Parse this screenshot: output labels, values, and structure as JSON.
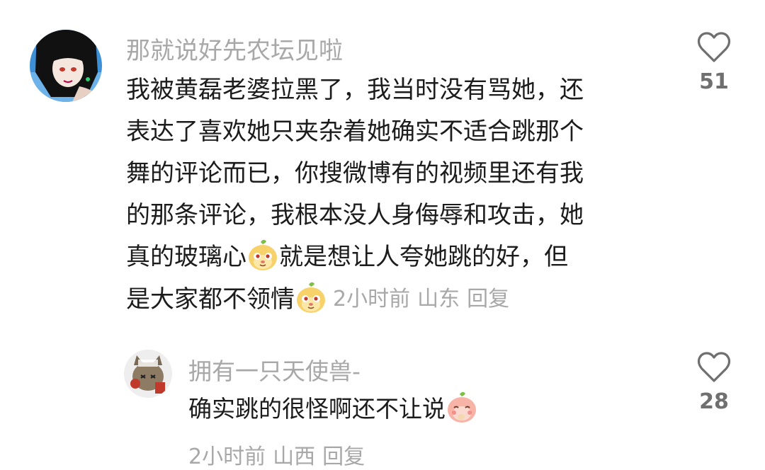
{
  "comments": [
    {
      "username": "那就说好先农坛见啦",
      "lines": [
        "我被黄磊老婆拉黑了，我当时没有骂她，还",
        "表达了喜欢她只夹杂着她确实不适合跳那个",
        "舞的评论而已，你搜微博有的视频里还有我",
        "的那条评论，我根本没人身侮辱和攻击，她"
      ],
      "line5_part1": "真的玻璃心",
      "line5_part2": "就是想让人夸她跳的好，但",
      "line6_part1": "是大家都不领情",
      "time": "2小时前",
      "location": "山东",
      "reply_label": "回复",
      "likes": "51",
      "emoji": "cheeky-face-sticker"
    },
    {
      "username": "拥有一只天使兽-",
      "text": "确实跳的很怪啊还不让说",
      "time": "2小时前",
      "location": "山西",
      "reply_label": "回复",
      "likes": "28",
      "emoji": "shy-face-sticker"
    }
  ],
  "colors": {
    "text": "#1c1c1c",
    "secondary": "#a8a8a8",
    "like_icon": "#6f6f6f"
  }
}
